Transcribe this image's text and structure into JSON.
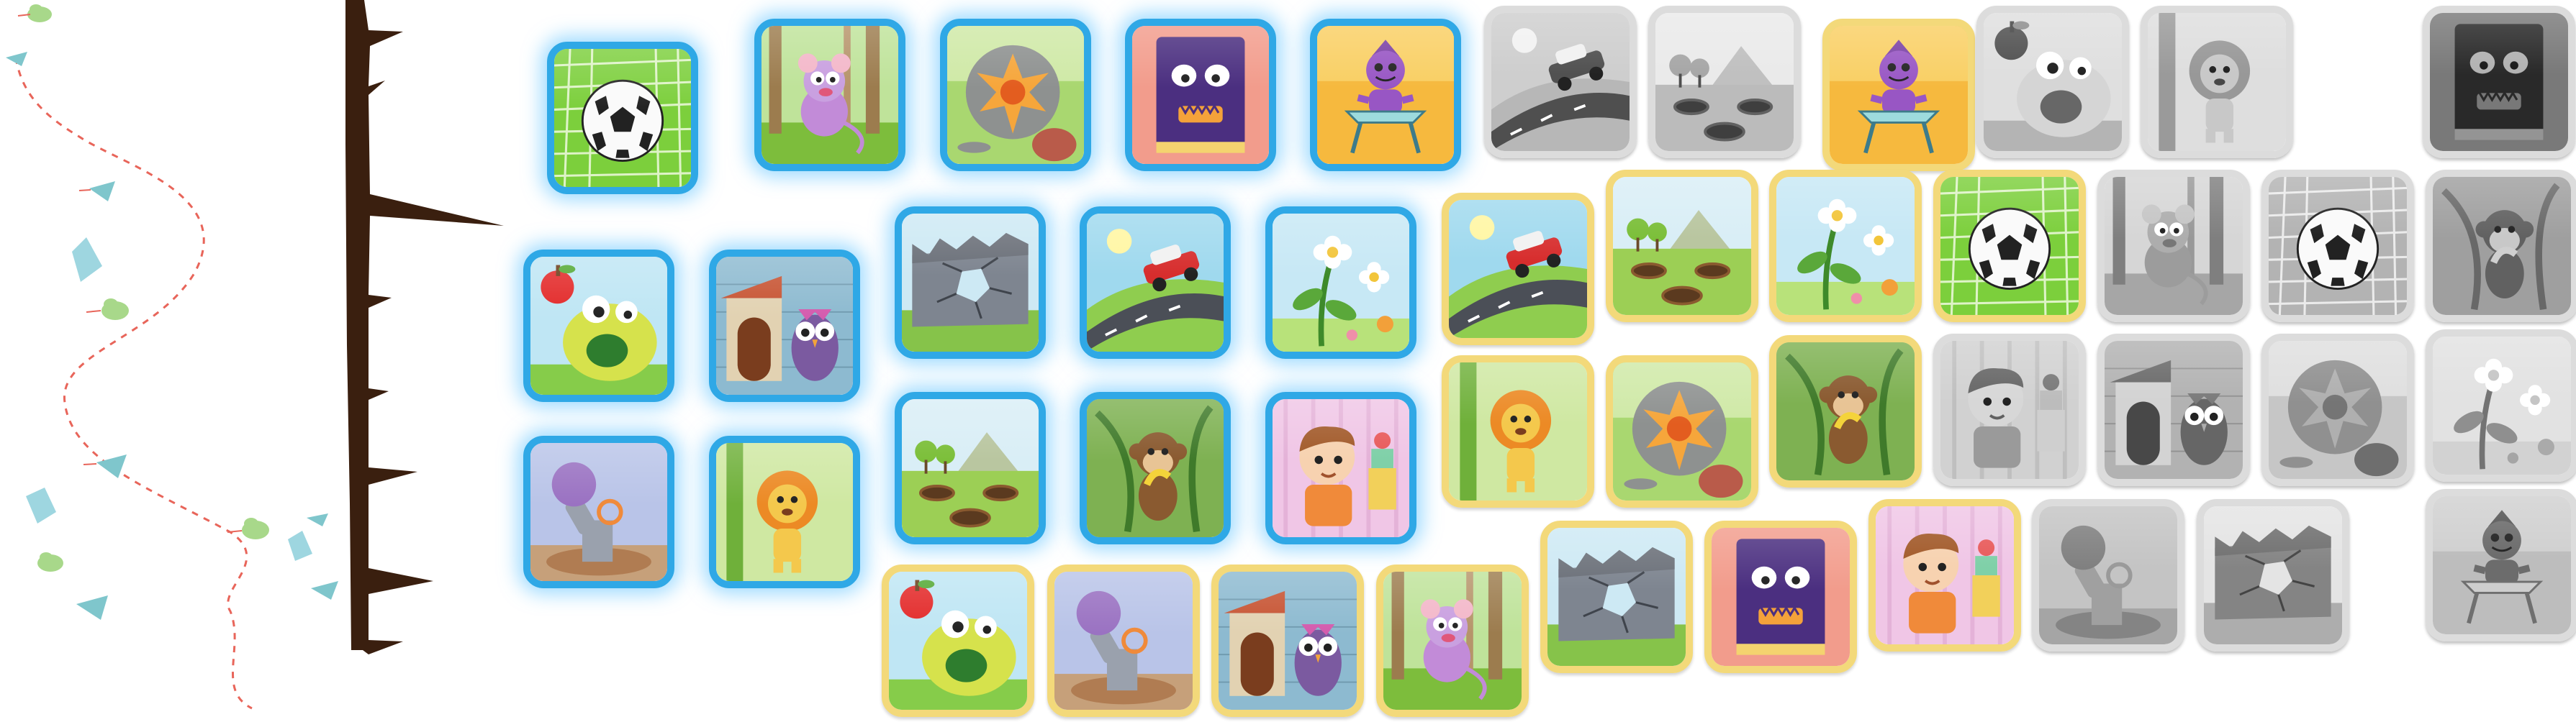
{
  "colors": {
    "trunk": "#3a1f0f",
    "path": "#e8655a",
    "leaf_teal": "#7fc6cc",
    "leaf_green": "#a8d88a",
    "frame_unlocked_blue": "#2fa8e6",
    "frame_collected_gold": "#f3d97a",
    "frame_locked_gray": "#dcdcdc"
  },
  "groups": [
    {
      "id": "unlocked",
      "state": "blue-glow",
      "tiles": [
        {
          "icon": "soccer-ball-icon"
        },
        {
          "icon": "mouse-in-forest-icon"
        },
        {
          "icon": "cracked-rock-icon"
        },
        {
          "icon": "purple-book-monster-icon"
        },
        {
          "icon": "purple-robot-icon"
        },
        {
          "icon": "green-apple-monster-icon"
        },
        {
          "icon": "owl-doghouse-icon"
        },
        {
          "icon": "cracked-wall-icon"
        },
        {
          "icon": "car-on-hill-icon"
        },
        {
          "icon": "flower-plant-icon"
        },
        {
          "icon": "purple-cannon-icon"
        },
        {
          "icon": "lion-icon"
        },
        {
          "icon": "hills-holes-icon"
        },
        {
          "icon": "monkey-banana-icon"
        },
        {
          "icon": "boy-icon"
        }
      ]
    },
    {
      "id": "collected",
      "state": "gold-frame",
      "tiles": [
        {
          "icon": "purple-robot-icon"
        },
        {
          "icon": "car-on-hill-icon"
        },
        {
          "icon": "hills-holes-icon"
        },
        {
          "icon": "flower-plant-icon"
        },
        {
          "icon": "soccer-ball-icon"
        },
        {
          "icon": "lion-icon"
        },
        {
          "icon": "cracked-rock-icon"
        },
        {
          "icon": "monkey-banana-icon"
        },
        {
          "icon": "cracked-wall-icon"
        },
        {
          "icon": "purple-book-monster-icon"
        },
        {
          "icon": "boy-icon"
        },
        {
          "icon": "green-apple-monster-icon"
        },
        {
          "icon": "purple-cannon-icon"
        },
        {
          "icon": "owl-doghouse-icon"
        },
        {
          "icon": "mouse-in-forest-icon"
        }
      ]
    },
    {
      "id": "locked",
      "state": "grayscale",
      "tiles": [
        {
          "icon": "car-on-hill-icon"
        },
        {
          "icon": "hills-holes-icon"
        },
        {
          "icon": "green-apple-monster-icon"
        },
        {
          "icon": "lion-icon"
        },
        {
          "icon": "purple-book-monster-icon"
        },
        {
          "icon": "mouse-in-forest-icon"
        },
        {
          "icon": "soccer-ball-icon"
        },
        {
          "icon": "monkey-banana-icon"
        },
        {
          "icon": "boy-icon"
        },
        {
          "icon": "owl-doghouse-icon"
        },
        {
          "icon": "cracked-rock-icon"
        },
        {
          "icon": "flower-plant-icon"
        },
        {
          "icon": "purple-cannon-icon"
        },
        {
          "icon": "cracked-wall-icon"
        },
        {
          "icon": "purple-robot-icon"
        }
      ]
    }
  ]
}
